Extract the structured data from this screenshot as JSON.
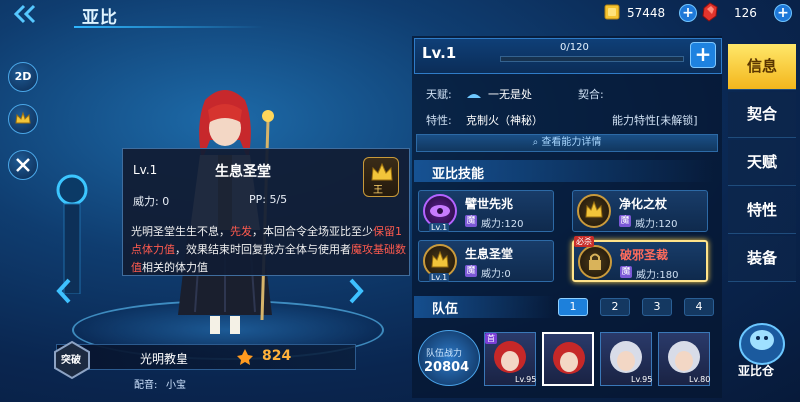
{
  "header": {
    "back_icon": "double-chevron-left-icon",
    "title": "亚比",
    "coins": "57448",
    "gems": "126",
    "accent": "#2fb7ff"
  },
  "left_buttons": [
    {
      "label": "2D",
      "icon": "2d-toggle-icon"
    },
    {
      "label": "",
      "icon": "crown-icon"
    },
    {
      "label": "",
      "icon": "skill-badge-icon"
    }
  ],
  "skill_popup": {
    "level": "Lv.1",
    "name": "生息圣堂",
    "power": "威力: 0",
    "pp": "PP: 5/5",
    "badge": "王",
    "desc_1": "光明圣堂生生不息，",
    "desc_red_1": "先发",
    "desc_2": "，本回合令全场亚比至少",
    "desc_red_2": "保留1点体力值",
    "desc_3": "，效果结束时回复我方全体与使用者",
    "desc_red_3": "魔攻基础数值",
    "desc_4": "相关的体力值"
  },
  "name_panel": {
    "break_label": "突破",
    "class_name": "光明教皇",
    "power_value": "824",
    "cv_label": "配音:",
    "cv_value": "小宝"
  },
  "level": {
    "label": "Lv.1",
    "xp_text": "0/120",
    "xp_progress": 0
  },
  "info": {
    "talent_label": "天赋:",
    "talent_value": "一无是处",
    "contract_label": "契合:",
    "contract_value": "",
    "trait_label": "特性:",
    "trait_value": "克制火（神秘）",
    "ability_label": "能力特性[未解锁]",
    "view_details": "查看能力详情"
  },
  "skills": {
    "title": "亚比技能",
    "items": [
      {
        "name": "譬世先兆",
        "attr": "魔",
        "power": "威力:120",
        "level": "Lv.1",
        "red": false,
        "active": false,
        "icon": "purple-eye-icon"
      },
      {
        "name": "净化之杖",
        "attr": "魔",
        "power": "威力:120",
        "level": "",
        "red": false,
        "active": false,
        "icon": "gold-crown-icon"
      },
      {
        "name": "生息圣堂",
        "attr": "魔",
        "power": "威力:0",
        "level": "Lv.1",
        "red": false,
        "active": false,
        "icon": "gold-crown-icon"
      },
      {
        "name": "破邪圣裁",
        "attr": "魔",
        "power": "威力:180",
        "level": "",
        "red": true,
        "active": true,
        "icon": "lock-icon",
        "tag": "必杀"
      }
    ]
  },
  "team": {
    "title": "队伍",
    "tabs": [
      "1",
      "2",
      "3",
      "4"
    ],
    "active_tab": 0,
    "power_label": "队伍战力",
    "power_value": "20804",
    "slots": [
      {
        "level": "Lv.95",
        "selected": false,
        "badge": "首"
      },
      {
        "level": "",
        "selected": true,
        "badge": ""
      },
      {
        "level": "Lv.95",
        "selected": false,
        "badge": ""
      },
      {
        "level": "Lv.80",
        "selected": false,
        "badge": ""
      }
    ]
  },
  "right_tabs": [
    "信息",
    "契合",
    "天赋",
    "特性",
    "装备"
  ],
  "active_right_tab": 0,
  "store": {
    "label": "亚比仓"
  }
}
